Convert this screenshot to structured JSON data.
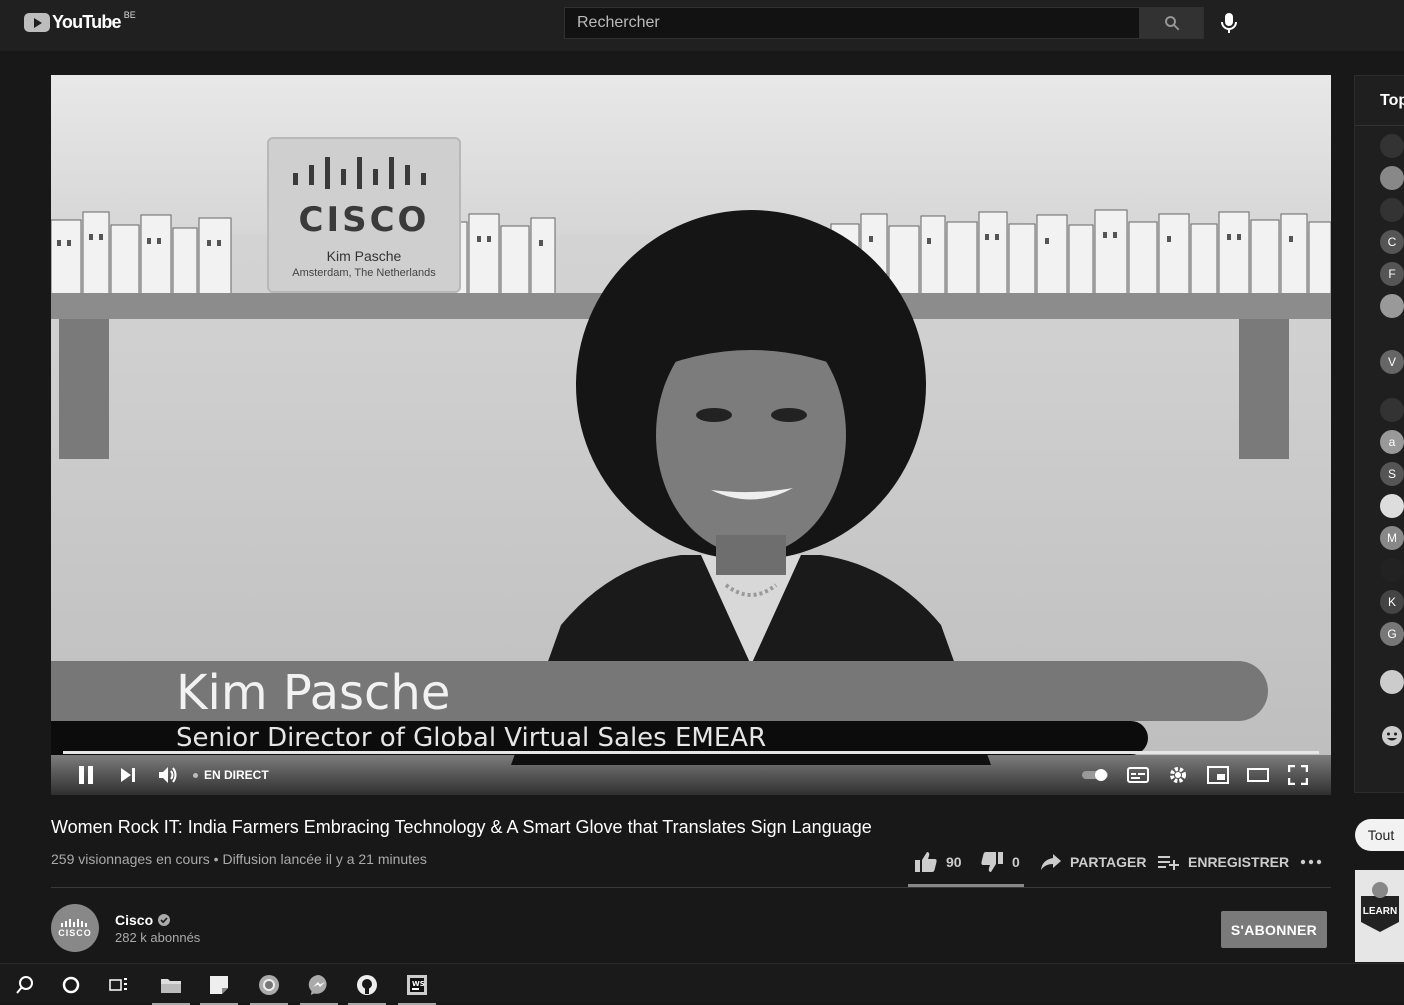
{
  "header": {
    "logo_text": "YouTube",
    "country_code": "BE",
    "search_placeholder": "Rechercher"
  },
  "video": {
    "sign_brand": "CISCO",
    "sign_name": "Kim Pasche",
    "sign_location": "Amsterdam, The Netherlands",
    "lower_third_name": "Kim Pasche",
    "lower_third_role": "Senior Director of Global Virtual Sales EMEAR",
    "live_label": "EN DIRECT",
    "progress": 1.0
  },
  "info": {
    "title": "Women Rock IT: India Farmers Embracing Technology & A Smart Glove that Translates Sign Language",
    "meta": "259 visionnages en cours • Diffusion lancée il y a 21 minutes",
    "likes": "90",
    "dislikes": "0",
    "share_label": "PARTAGER",
    "save_label": "ENREGISTRER"
  },
  "channel": {
    "name": "Cisco",
    "subscribers": "282 k abonnés",
    "avatar_text": "CISCO",
    "subscribe_label": "S'ABONNER"
  },
  "chat": {
    "header": "Top",
    "avatars": [
      "",
      "",
      "",
      "C",
      "F",
      "",
      "V",
      "",
      "a",
      "S",
      "",
      "M",
      "",
      "K",
      "G",
      "",
      ""
    ],
    "filter_chip": "Tout",
    "ad_text": "LEARN"
  },
  "taskbar": {
    "items": [
      "search-icon",
      "cortana-icon",
      "task-view-icon",
      "file-explorer-icon",
      "sticky-notes-icon",
      "chrome-icon",
      "messenger-icon",
      "github-icon",
      "webstorm-icon"
    ]
  }
}
